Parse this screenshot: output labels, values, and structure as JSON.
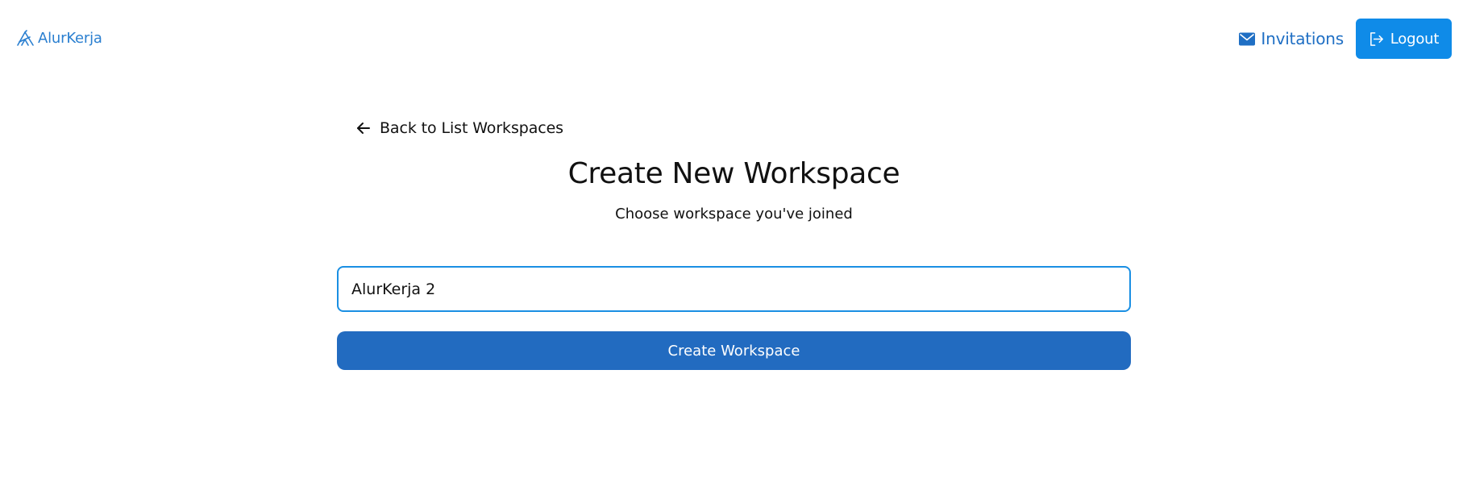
{
  "header": {
    "logo_text": "AlurKerja",
    "invitations_label": "Invitations",
    "logout_label": "Logout"
  },
  "main": {
    "back_label": "Back to List Workspaces",
    "title": "Create New Workspace",
    "subtitle": "Choose workspace you've joined",
    "workspace_name_value": "AlurKerja 2",
    "create_button_label": "Create Workspace"
  },
  "icons": {
    "logo": "alurkerja-logo-icon",
    "invitations": "envelope-icon",
    "logout": "sign-out-icon",
    "back": "arrow-left-icon"
  },
  "colors": {
    "brand": "#2a7fd0",
    "link": "#1f6fc4",
    "logout_bg": "#0f8be8",
    "primary_button": "#226bc0",
    "input_focus_border": "#1a8fe3"
  }
}
